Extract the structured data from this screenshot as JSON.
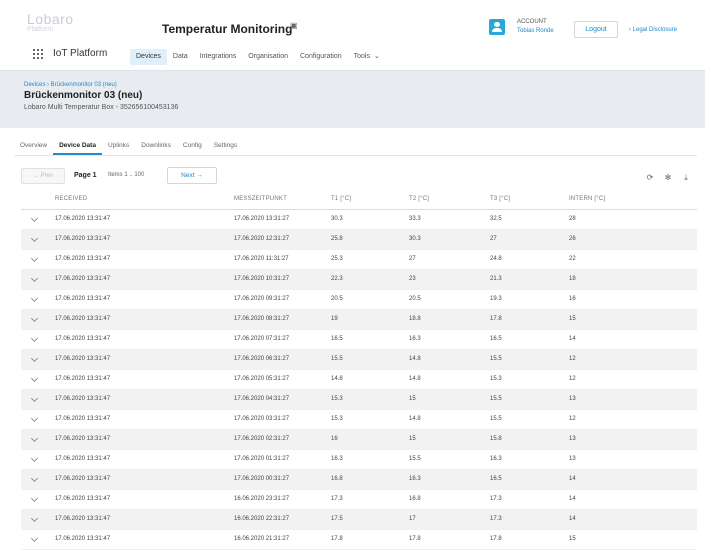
{
  "brand": {
    "logo_text": "Lobaro",
    "logo_sub": "Platform"
  },
  "header": {
    "app_title": "Temperatur Monitoring",
    "account_label": "ACCOUNT",
    "account_name": "Tobias Ronde",
    "logout_label": "Logout",
    "legal_label": "› Legal Disclosure"
  },
  "nav": {
    "platform_name": "IoT Platform",
    "items": [
      {
        "label": "Devices",
        "active": true
      },
      {
        "label": "Data",
        "active": false
      },
      {
        "label": "Integrations",
        "active": false
      },
      {
        "label": "Organisation",
        "active": false
      },
      {
        "label": "Configuration",
        "active": false
      },
      {
        "label": "Tools",
        "active": false
      }
    ]
  },
  "device": {
    "breadcrumb": "Devices › Brückenmonitor 03 (neu)",
    "title": "Brückenmonitor 03 (neu)",
    "subtitle": "Lobaro Multi Temperatur Box - 352656100453136"
  },
  "tabs": [
    {
      "label": "Overview",
      "active": false
    },
    {
      "label": "Device Data",
      "active": true
    },
    {
      "label": "Uplinks",
      "active": false
    },
    {
      "label": "Downlinks",
      "active": false
    },
    {
      "label": "Config",
      "active": false
    },
    {
      "label": "Settings",
      "active": false
    }
  ],
  "pagination": {
    "prev_label": "← Prev",
    "page_label": "Page 1",
    "items_label": "Items 1 .. 100",
    "next_label": "Next →"
  },
  "tools": {
    "refresh_icon": "refresh-icon",
    "settings_icon": "gear-icon",
    "download_icon": "download-icon"
  },
  "table": {
    "columns": [
      "RECEIVED",
      "MESSZEITPUNKT",
      "T1 [°C]",
      "T2 [°C]",
      "T3 [°C]",
      "INTERN [°C]"
    ],
    "rows": [
      [
        "17.06.2020 13:31:47",
        "17.06.2020 13:31:27",
        "30.3",
        "33.3",
        "32.5",
        "28"
      ],
      [
        "17.06.2020 13:31:47",
        "17.06.2020 12:31:27",
        "25.8",
        "30.3",
        "27",
        "26"
      ],
      [
        "17.06.2020 13:31:47",
        "17.06.2020 11:31:27",
        "25.3",
        "27",
        "24.8",
        "22"
      ],
      [
        "17.06.2020 13:31:47",
        "17.06.2020 10:31:27",
        "22.3",
        "23",
        "21.3",
        "18"
      ],
      [
        "17.06.2020 13:31:47",
        "17.06.2020 09:31:27",
        "20.5",
        "20.5",
        "19.3",
        "16"
      ],
      [
        "17.06.2020 13:31:47",
        "17.06.2020 08:31:27",
        "19",
        "18.8",
        "17.8",
        "15"
      ],
      [
        "17.06.2020 13:31:47",
        "17.06.2020 07:31:27",
        "16.5",
        "16.3",
        "16.5",
        "14"
      ],
      [
        "17.06.2020 13:31:47",
        "17.06.2020 06:31:27",
        "15.5",
        "14.8",
        "15.5",
        "12"
      ],
      [
        "17.06.2020 13:31:47",
        "17.06.2020 05:31:27",
        "14.8",
        "14.8",
        "15.3",
        "12"
      ],
      [
        "17.06.2020 13:31:47",
        "17.06.2020 04:31:27",
        "15.3",
        "15",
        "15.5",
        "13"
      ],
      [
        "17.06.2020 13:31:47",
        "17.06.2020 03:31:27",
        "15.3",
        "14.8",
        "15.5",
        "12"
      ],
      [
        "17.06.2020 13:31:47",
        "17.06.2020 02:31:27",
        "16",
        "15",
        "15.8",
        "13"
      ],
      [
        "17.06.2020 13:31:47",
        "17.06.2020 01:31:27",
        "16.3",
        "15.5",
        "16.3",
        "13"
      ],
      [
        "17.06.2020 13:31:47",
        "17.06.2020 00:31:27",
        "16.8",
        "16.3",
        "16.5",
        "14"
      ],
      [
        "17.06.2020 13:31:47",
        "16.06.2020 23:31:27",
        "17.3",
        "16.8",
        "17.3",
        "14"
      ],
      [
        "17.06.2020 13:31:47",
        "16.06.2020 22:31:27",
        "17.5",
        "17",
        "17.3",
        "14"
      ],
      [
        "17.06.2020 13:31:47",
        "16.06.2020 21:31:27",
        "17.8",
        "17.8",
        "17.8",
        "15"
      ]
    ]
  },
  "colors": {
    "accent": "#1f88c8",
    "account_icon": "#29a8d8",
    "active_nav_bg": "#dff0fa",
    "device_header_bg": "#e8ecf1",
    "row_stripe": "#f2f2f2"
  }
}
